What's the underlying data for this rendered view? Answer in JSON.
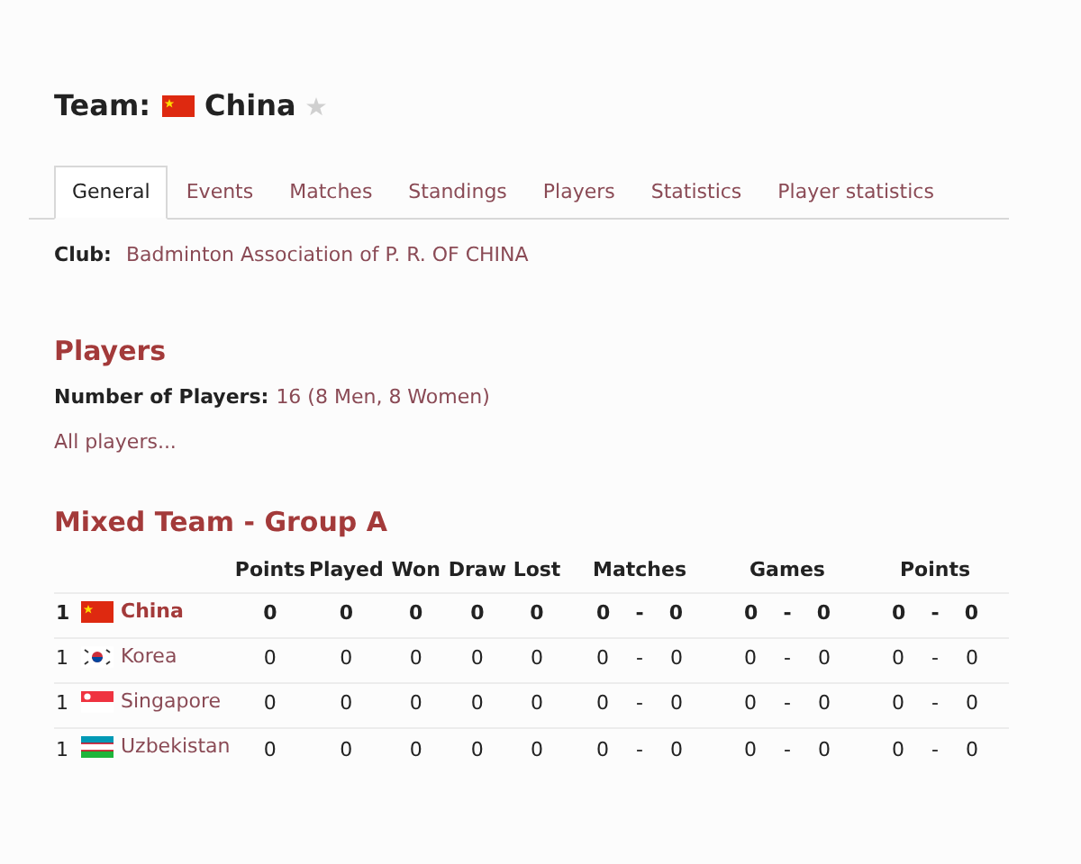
{
  "team_header": {
    "label": "Team:",
    "name": "China"
  },
  "tabs": [
    {
      "label": "General",
      "selected": true
    },
    {
      "label": "Events",
      "selected": false
    },
    {
      "label": "Matches",
      "selected": false
    },
    {
      "label": "Standings",
      "selected": false
    },
    {
      "label": "Players",
      "selected": false
    },
    {
      "label": "Statistics",
      "selected": false
    },
    {
      "label": "Player statistics",
      "selected": false
    }
  ],
  "club": {
    "label": "Club:",
    "value": "Badminton Association of P. R. OF CHINA"
  },
  "players_section": {
    "title": "Players",
    "count_label": "Number of Players:",
    "count_value": "16 (8 Men, 8 Women)",
    "all_link": "All players..."
  },
  "standings": {
    "title": "Mixed Team - Group A",
    "columns": [
      "Points",
      "Played",
      "Won",
      "Draw",
      "Lost",
      "Matches",
      "Games",
      "Points"
    ],
    "rows": [
      {
        "rank": "1",
        "team": "China",
        "selected": true,
        "points": "0",
        "played": "0",
        "won": "0",
        "draw": "0",
        "lost": "0",
        "matches": [
          "0",
          "-",
          "0"
        ],
        "games": [
          "0",
          "-",
          "0"
        ],
        "points_scored": [
          "0",
          "-",
          "0"
        ]
      },
      {
        "rank": "1",
        "team": "Korea",
        "selected": false,
        "points": "0",
        "played": "0",
        "won": "0",
        "draw": "0",
        "lost": "0",
        "matches": [
          "0",
          "-",
          "0"
        ],
        "games": [
          "0",
          "-",
          "0"
        ],
        "points_scored": [
          "0",
          "-",
          "0"
        ]
      },
      {
        "rank": "1",
        "team": "Singapore",
        "selected": false,
        "points": "0",
        "played": "0",
        "won": "0",
        "draw": "0",
        "lost": "0",
        "matches": [
          "0",
          "-",
          "0"
        ],
        "games": [
          "0",
          "-",
          "0"
        ],
        "points_scored": [
          "0",
          "-",
          "0"
        ]
      },
      {
        "rank": "1",
        "team": "Uzbekistan",
        "selected": false,
        "points": "0",
        "played": "0",
        "won": "0",
        "draw": "0",
        "lost": "0",
        "matches": [
          "0",
          "-",
          "0"
        ],
        "games": [
          "0",
          "-",
          "0"
        ],
        "points_scored": [
          "0",
          "-",
          "0"
        ]
      }
    ]
  }
}
